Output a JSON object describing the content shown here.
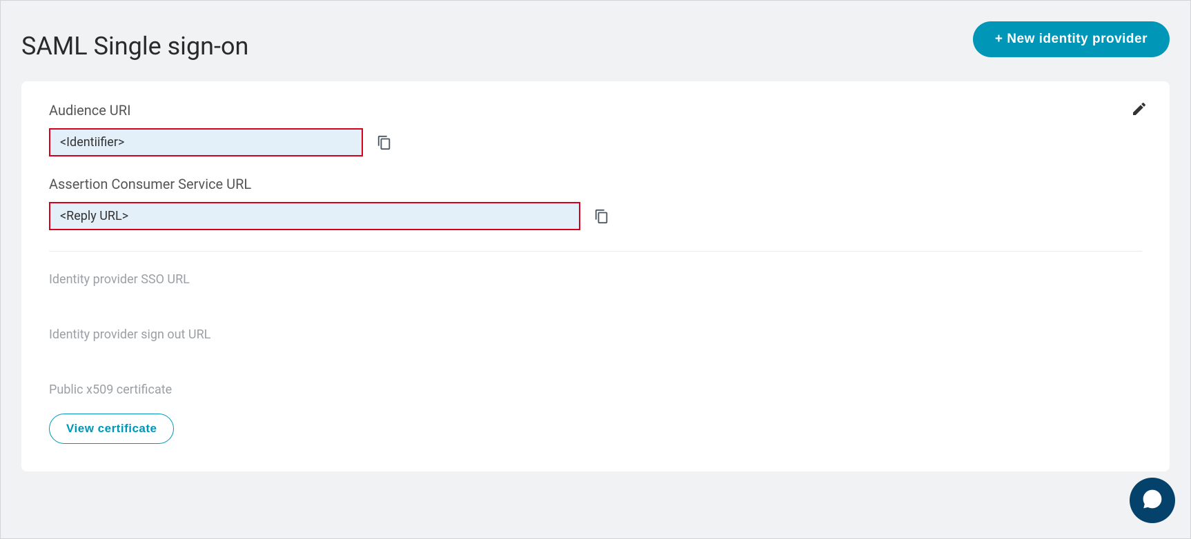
{
  "header": {
    "title": "SAML Single sign-on",
    "new_provider_label": "+ New identity provider"
  },
  "fields": {
    "audience": {
      "label": "Audience URI",
      "value": "<Identiifier>"
    },
    "acs": {
      "label": "Assertion Consumer Service URL",
      "value": "<Reply URL>"
    },
    "sso_url": {
      "label": "Identity provider SSO URL"
    },
    "signout_url": {
      "label": "Identity provider sign out URL"
    },
    "certificate": {
      "label": "Public x509 certificate",
      "view_label": "View certificate"
    }
  }
}
